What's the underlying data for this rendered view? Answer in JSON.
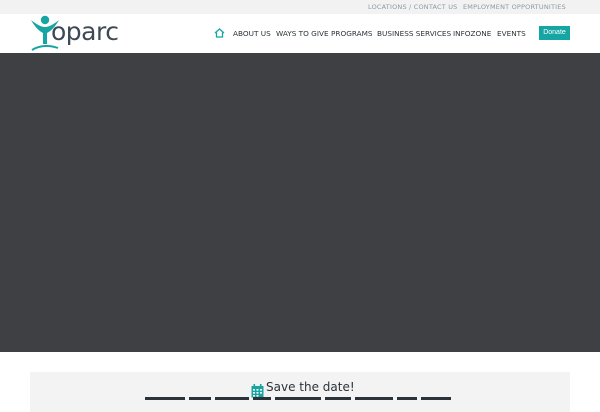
{
  "topbar": {
    "locations_label": "LOCATIONS / CONTACT US",
    "employment_label": "EMPLOYMENT OPPORTUNITIES"
  },
  "logo": {
    "text": "oparc",
    "icon": "person-arms-up-icon"
  },
  "nav": {
    "home_icon": "home-icon",
    "items": [
      {
        "label": "ABOUT US"
      },
      {
        "label": "WAYS TO GIVE"
      },
      {
        "label": "PROGRAMS"
      },
      {
        "label": "BUSINESS SERVICES"
      },
      {
        "label": "INFOZONE"
      },
      {
        "label": "EVENTS"
      }
    ],
    "donate_label": "Donate"
  },
  "notice": {
    "icon": "calendar-icon",
    "title": "Save the date!"
  },
  "colors": {
    "accent": "#17a5a3",
    "hero": "#3f4044",
    "text": "#2b3338"
  }
}
